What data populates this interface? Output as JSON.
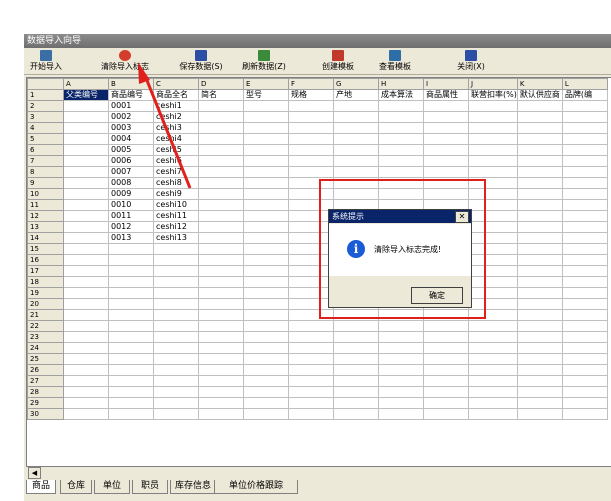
{
  "window": {
    "title": "数据导入向导"
  },
  "toolbar": {
    "items": [
      {
        "label": "开始导入",
        "icon": "import-icon",
        "color": "#3a6ea5"
      },
      {
        "label": "清除导入标志",
        "icon": "clear-flag-icon",
        "color": "#d43c2c"
      },
      {
        "label": "保存数据(S)",
        "icon": "save-icon",
        "color": "#2c4ea5"
      },
      {
        "label": "刷新数据(Z)",
        "icon": "refresh-icon",
        "color": "#3a8a3a"
      },
      {
        "label": "创建模板",
        "icon": "create-template-icon",
        "color": "#c0392b"
      },
      {
        "label": "查看模板",
        "icon": "view-template-icon",
        "color": "#2c6ea5"
      },
      {
        "label": "关闭(X)",
        "icon": "close-window-icon",
        "color": "#2c4ea5"
      }
    ]
  },
  "grid": {
    "columns": [
      "A",
      "B",
      "C",
      "D",
      "E",
      "F",
      "G",
      "H",
      "I",
      "J",
      "K",
      "L"
    ],
    "header_row": [
      "父类编号",
      "商品编号",
      "商品全名",
      "简名",
      "型号",
      "规格",
      "产地",
      "成本算法",
      "商品属性",
      "联营扣率(%)",
      "默认供应商",
      "品牌(编"
    ],
    "rows": [
      [
        "0001",
        "ceshi1"
      ],
      [
        "0002",
        "ceshi2"
      ],
      [
        "0003",
        "ceshi3"
      ],
      [
        "0004",
        "ceshi4"
      ],
      [
        "0005",
        "ceshi5"
      ],
      [
        "0006",
        "ceshi6"
      ],
      [
        "0007",
        "ceshi7"
      ],
      [
        "0008",
        "ceshi8"
      ],
      [
        "0009",
        "ceshi9"
      ],
      [
        "0010",
        "ceshi10"
      ],
      [
        "0011",
        "ceshi11"
      ],
      [
        "0012",
        "ceshi12"
      ],
      [
        "0013",
        "ceshi13"
      ]
    ],
    "row_count": 30
  },
  "tabs": [
    "商品",
    "仓库",
    "单位",
    "职员",
    "库存信息",
    "单位价格跟踪"
  ],
  "dialog": {
    "title": "系统提示",
    "message": "清除导入标志完成!",
    "ok": "确定",
    "close": "✕"
  },
  "scroll": {
    "left_arrow": "◀"
  },
  "colors": {
    "highlight": "#e0201c",
    "selection": "#0a246a"
  }
}
